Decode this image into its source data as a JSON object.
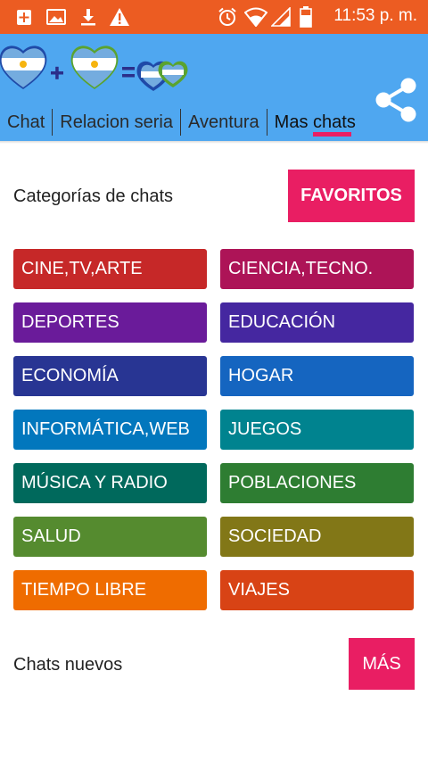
{
  "status_bar": {
    "time": "11:53 p. m.",
    "icons": [
      "add-box-icon",
      "image-icon",
      "download-icon",
      "warning-icon",
      "alarm-icon",
      "wifi-icon",
      "signal-icon",
      "battery-icon"
    ]
  },
  "app_bar": {
    "logo": "flag-hearts-logo",
    "share_icon": "share-icon",
    "tabs": [
      {
        "label": "Chat"
      },
      {
        "label": "Relacion seria"
      },
      {
        "label": "Aventura"
      },
      {
        "label": "Mas chats",
        "active": true
      }
    ]
  },
  "categories_section": {
    "title": "Categorías de chats",
    "favorites_label": "FAVORITOS"
  },
  "categories": [
    {
      "label": "CINE,TV,ARTE",
      "color": "#c62828"
    },
    {
      "label": "CIENCIA,TECNO.",
      "color": "#ad1457"
    },
    {
      "label": "DEPORTES",
      "color": "#6a1b9a"
    },
    {
      "label": "EDUCACIÓN",
      "color": "#4527a0"
    },
    {
      "label": "ECONOMÍA",
      "color": "#283593"
    },
    {
      "label": "HOGAR",
      "color": "#1565c0"
    },
    {
      "label": "INFORMÁTICA,WEB",
      "color": "#0277bd"
    },
    {
      "label": "JUEGOS",
      "color": "#00838f"
    },
    {
      "label": "MÚSICA Y RADIO",
      "color": "#00695c"
    },
    {
      "label": "POBLACIONES",
      "color": "#2e7d32"
    },
    {
      "label": "SALUD",
      "color": "#558b2f"
    },
    {
      "label": "SOCIEDAD",
      "color": "#827717"
    },
    {
      "label": "TIEMPO LIBRE",
      "color": "#ef6c00"
    },
    {
      "label": "VIAJES",
      "color": "#d84315"
    }
  ],
  "new_chats_section": {
    "title": "Chats nuevos",
    "more_label": "MÁS"
  }
}
